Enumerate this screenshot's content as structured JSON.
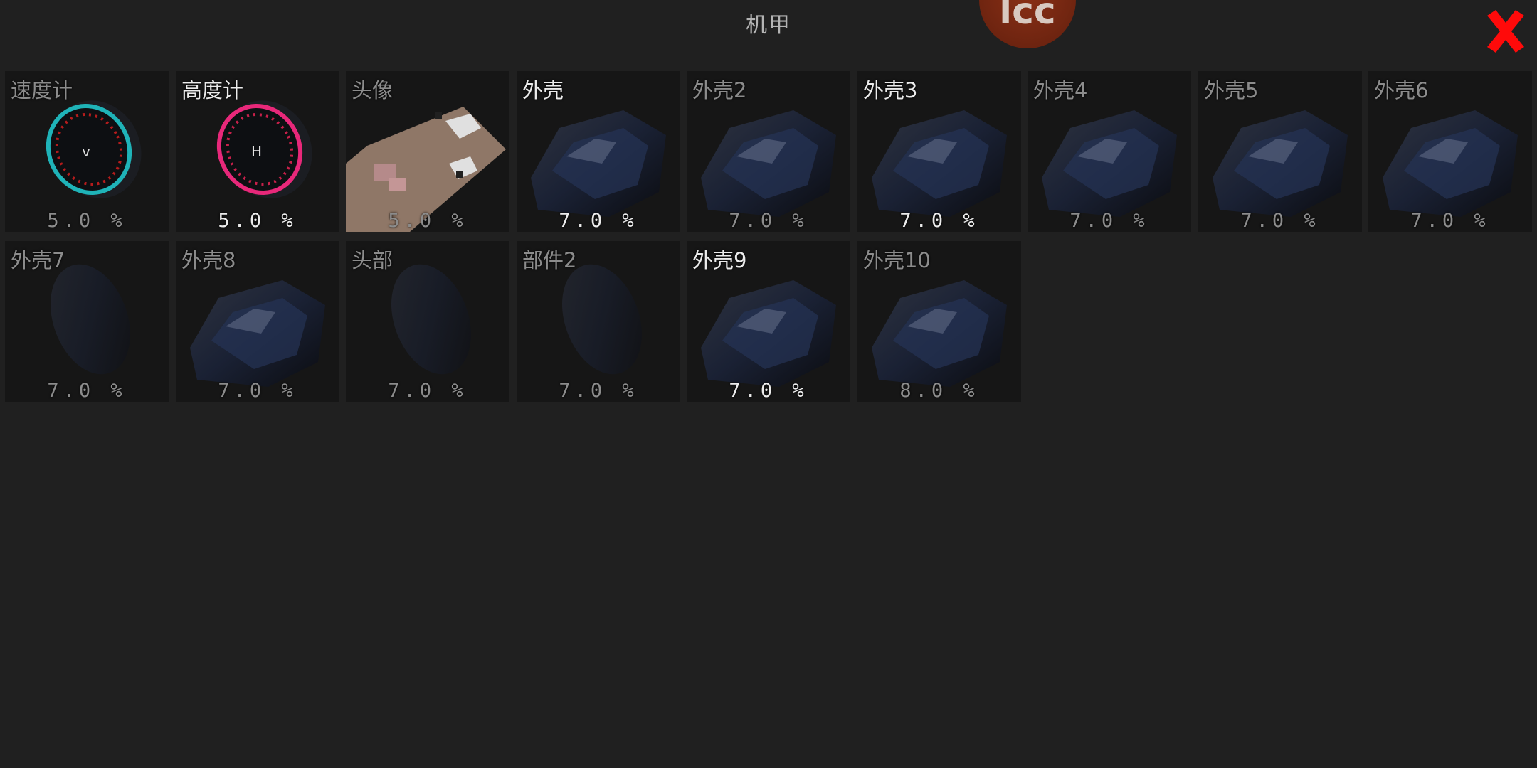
{
  "header": {
    "title": "机甲",
    "logo_text": "lcc"
  },
  "close_icon": "close-x-icon",
  "colors": {
    "background": "#202020",
    "tile": "#161616",
    "close": "#ff0000",
    "text_dim": "#8c8c8c",
    "text_selected": "#ececec"
  },
  "parts": [
    {
      "name": "速度计",
      "pct": "5.0 %",
      "selected": false,
      "icon": "speedometer-icon"
    },
    {
      "name": "高度计",
      "pct": "5.0 %",
      "selected": true,
      "icon": "altimeter-icon"
    },
    {
      "name": "头像",
      "pct": "5.0 %",
      "selected": false,
      "icon": "pixel-avatar-icon"
    },
    {
      "name": "外壳",
      "pct": "7.0 %",
      "selected": true,
      "icon": "shell-icon"
    },
    {
      "name": "外壳2",
      "pct": "7.0 %",
      "selected": false,
      "icon": "shell-icon"
    },
    {
      "name": "外壳3",
      "pct": "7.0 %",
      "selected": true,
      "icon": "shell-icon"
    },
    {
      "name": "外壳4",
      "pct": "7.0 %",
      "selected": false,
      "icon": "shell-icon"
    },
    {
      "name": "外壳5",
      "pct": "7.0 %",
      "selected": false,
      "icon": "shell-icon"
    },
    {
      "name": "外壳6",
      "pct": "7.0 %",
      "selected": false,
      "icon": "shell-icon"
    },
    {
      "name": "外壳7",
      "pct": "7.0 %",
      "selected": false,
      "icon": "shell-icon"
    },
    {
      "name": "外壳8",
      "pct": "7.0 %",
      "selected": false,
      "icon": "shell-icon"
    },
    {
      "name": "头部",
      "pct": "7.0 %",
      "selected": false,
      "icon": "head-part-icon"
    },
    {
      "name": "部件2",
      "pct": "7.0 %",
      "selected": false,
      "icon": "part-icon"
    },
    {
      "name": "外壳9",
      "pct": "7.0 %",
      "selected": true,
      "icon": "shell-icon"
    },
    {
      "name": "外壳10",
      "pct": "8.0 %",
      "selected": false,
      "icon": "shell-icon"
    }
  ]
}
